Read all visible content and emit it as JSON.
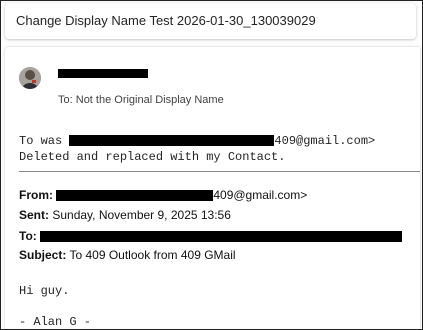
{
  "window": {
    "title": "Change Display Name Test 2026-01-30_130039029"
  },
  "message": {
    "sender": {
      "name": "[redacted]"
    },
    "to": {
      "label": "To:",
      "name": "Not the Original Display Name"
    },
    "body_top": {
      "line1_prefix": "To was ",
      "line1_suffix": "409@gmail.com>",
      "line2": "Deleted and replaced with my Contact."
    },
    "forwarded": {
      "from_label": "From:",
      "from_suffix": "409@gmail.com>",
      "sent_label": "Sent:",
      "sent_value": "Sunday, November 9, 2025 13:56",
      "to_label": "To:",
      "subject_label": "Subject:",
      "subject_value": "To 409 Outlook from 409 GMail"
    },
    "body_bottom": {
      "greeting": "Hi guy.",
      "signature": "- Alan G -"
    }
  },
  "colors": {
    "text": "#242424",
    "redaction": "#000000",
    "divider": "#8a8a8a"
  },
  "icons": {
    "avatar": "user-avatar-photo"
  }
}
